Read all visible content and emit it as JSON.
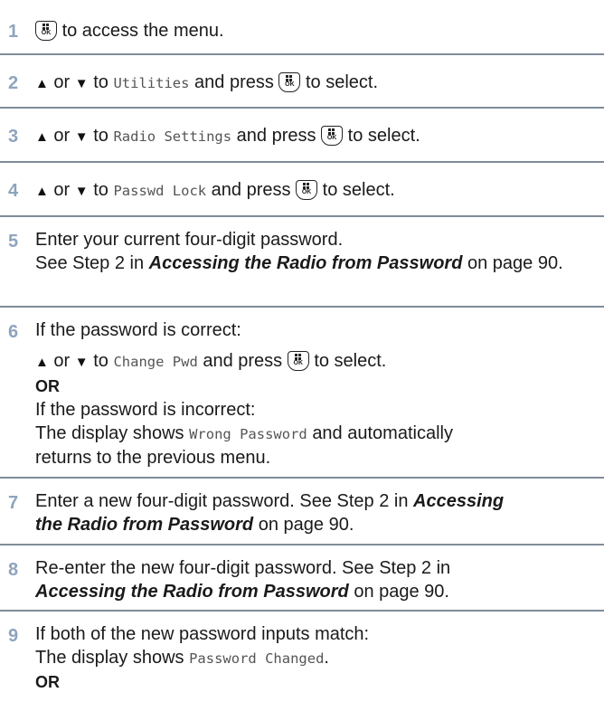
{
  "steps": [
    {
      "num": "1",
      "icon": "ok-menu-button-icon",
      "text": "to access the menu."
    },
    {
      "num": "2",
      "or": "or",
      "to": "to",
      "item": "Utilities",
      "press": "and press",
      "select": "to select."
    },
    {
      "num": "3",
      "or": "or",
      "to": "to",
      "item": "Radio Settings",
      "press": "and press",
      "select": "to select."
    },
    {
      "num": "4",
      "or": "or",
      "to": "to",
      "item": "Passwd Lock",
      "press": "and press",
      "select": "to select."
    },
    {
      "num": "5",
      "line1": "Enter your current four-digit password.",
      "see": "See Step 2 in",
      "ref": "Accessing the Radio from Password",
      "on_page": "on page 90."
    },
    {
      "num": "6",
      "line1": "If the password is correct:",
      "or": "or",
      "to": "to",
      "item": "Change Pwd",
      "press": "and press",
      "select": "to select.",
      "or_bold": "OR",
      "incorrect": "If the password is incorrect:",
      "display_shows": "The display shows",
      "display_value": "Wrong Password",
      "auto": "and automatically",
      "returns": "returns to the previous menu."
    },
    {
      "num": "7",
      "line1": "Enter a new four-digit password. See Step 2 in",
      "ref_a": "Accessing",
      "ref_b": "the Radio from Password",
      "on_page": "on page 90."
    },
    {
      "num": "8",
      "line1": "Re-enter the new four-digit password.  See Step 2 in",
      "ref": "Accessing the Radio from Password",
      "on_page": "on page 90."
    },
    {
      "num": "9",
      "line1": "If both of the new password inputs match:",
      "display_shows": "The display shows",
      "display_value": "Password Changed",
      "period": ".",
      "or_bold": "OR"
    }
  ],
  "colors": {
    "step_number": "#8ea4bd",
    "divider": "#7f8c99"
  }
}
